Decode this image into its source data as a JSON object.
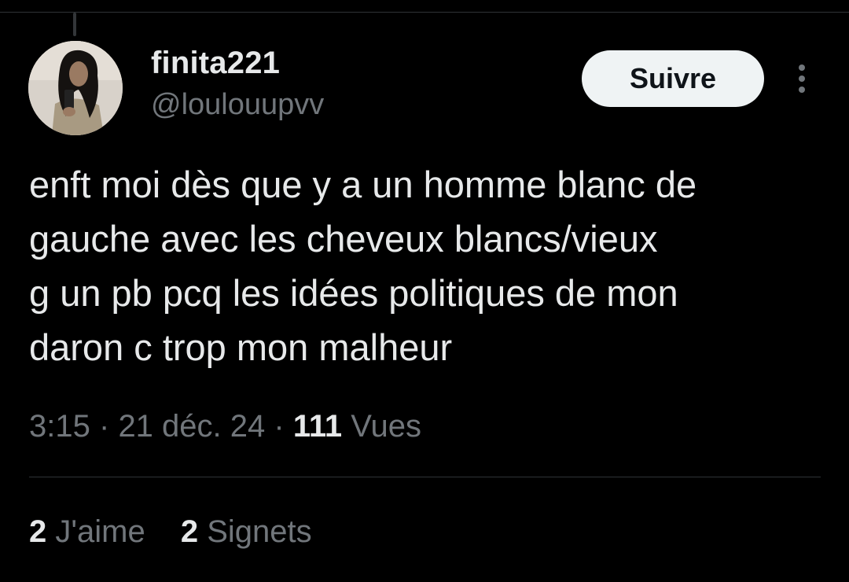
{
  "user": {
    "display_name": "finita221",
    "handle": "@loulouupvv",
    "avatar_icon": "profile-photo"
  },
  "follow_button": {
    "label": "Suivre"
  },
  "more_icon": "more-vertical-icon",
  "tweet": {
    "text": "enft moi dès que y a un homme blanc de\ngauche avec les cheveux blancs/vieux\ng un pb pcq les idées politiques de mon\ndaron c trop mon malheur"
  },
  "meta": {
    "time": "3:15",
    "separator": "·",
    "date": "21 déc. 24",
    "views_count": "111",
    "views_label": "Vues"
  },
  "stats": {
    "likes_count": "2",
    "likes_label": "J'aime",
    "bookmarks_count": "2",
    "bookmarks_label": "Signets"
  },
  "colors": {
    "background": "#000000",
    "text_primary": "#e7e9ea",
    "text_secondary": "#71767b",
    "divider": "#2f3336",
    "button_bg": "#eff3f4",
    "button_text": "#0f1419"
  }
}
